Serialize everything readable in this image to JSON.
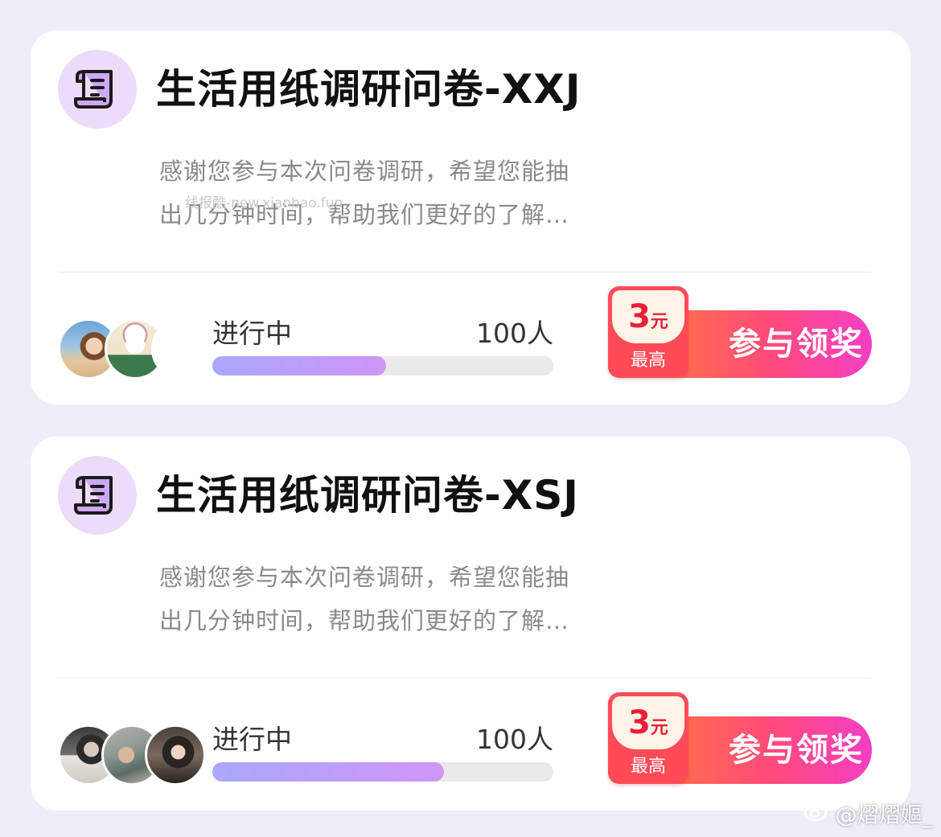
{
  "surveys": [
    {
      "title": "生活用纸调研问卷-XXJ",
      "description_lines": [
        "感谢您参与本次问卷调研，希望您能抽",
        "出几分钟时间，帮助我们更好的了解…"
      ],
      "watermark": "线报酷-new.xianbao.fun",
      "status": "进行中",
      "participants": "100人",
      "progress": 0.51,
      "reward_amount": "3",
      "reward_unit": "元",
      "reward_note": "最高",
      "button_label": "参与领奖"
    },
    {
      "title": "生活用纸调研问卷-XSJ",
      "description_lines": [
        "感谢您参与本次问卷调研，希望您能抽",
        "出几分钟时间，帮助我们更好的了解…"
      ],
      "status": "进行中",
      "participants": "100人",
      "progress": 0.68,
      "reward_amount": "3",
      "reward_unit": "元",
      "reward_note": "最高",
      "button_label": "参与领奖"
    }
  ],
  "brand_mark": "@熠熠嫗_",
  "icons": {
    "survey": "scroll-document-icon",
    "brand": "weibo-logo-icon"
  },
  "colors": {
    "icon_bg": "#ecdcf9",
    "icon_fg": "#7b3fcf",
    "progress": "#c09af8",
    "cta": "#ff4b78",
    "reward_bg": "#ff4b57"
  }
}
